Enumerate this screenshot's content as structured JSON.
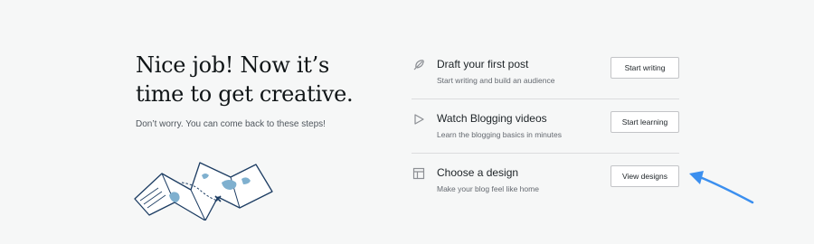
{
  "intro": {
    "headline_line1": "Nice job! Now it’s",
    "headline_line2": "time to get creative.",
    "subtext": "Don’t worry. You can come back to these steps!"
  },
  "steps": [
    {
      "icon": "feather-icon",
      "title": "Draft your first post",
      "description": "Start writing and build an audience",
      "button_label": "Start writing"
    },
    {
      "icon": "play-icon",
      "title": "Watch Blogging videos",
      "description": "Learn the blogging basics in minutes",
      "button_label": "Start learning"
    },
    {
      "icon": "layout-icon",
      "title": "Choose a design",
      "description": "Make your blog feel like home",
      "button_label": "View designs"
    }
  ],
  "colors": {
    "background": "#f6f7f7",
    "map_stroke": "#1d3d63",
    "map_fill": "#7fb0cf",
    "arrow": "#3b8fef"
  }
}
